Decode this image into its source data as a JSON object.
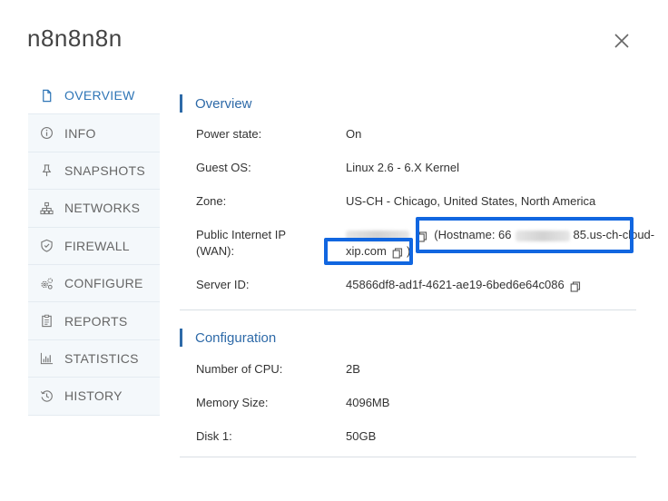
{
  "title": "n8n8n8n",
  "sidebar": {
    "items": [
      {
        "label": "OVERVIEW",
        "icon": "document-icon",
        "active": true
      },
      {
        "label": "INFO",
        "icon": "info-icon"
      },
      {
        "label": "SNAPSHOTS",
        "icon": "pin-icon"
      },
      {
        "label": "NETWORKS",
        "icon": "network-icon"
      },
      {
        "label": "FIREWALL",
        "icon": "shield-icon"
      },
      {
        "label": "CONFIGURE",
        "icon": "gears-icon"
      },
      {
        "label": "REPORTS",
        "icon": "clipboard-icon"
      },
      {
        "label": "STATISTICS",
        "icon": "bar-chart-icon"
      },
      {
        "label": "HISTORY",
        "icon": "history-icon"
      }
    ]
  },
  "overview": {
    "title": "Overview",
    "power_label": "Power state:",
    "power_value": "On",
    "os_label": "Guest OS:",
    "os_value": "Linux 2.6 - 6.X Kernel",
    "zone_label": "Zone:",
    "zone_value": "US-CH - Chicago, United States, North America",
    "ip_label_line1": "Public Internet IP",
    "ip_label_line2": "(WAN):",
    "hostname_prefix": "(Hostname: 66",
    "hostname_suffix": "85.us-ch-cloud-",
    "hostname_line2": "xip.com",
    "hostname_close": ")",
    "server_id_label": "Server ID:",
    "server_id_value": "45866df8-ad1f-4621-ae19-6bed6e64c086"
  },
  "configuration": {
    "title": "Configuration",
    "cpu_label": "Number of CPU:",
    "cpu_value": "2B",
    "memory_label": "Memory Size:",
    "memory_value": "4096MB",
    "disk_label": "Disk 1:",
    "disk_value": "50GB"
  },
  "colors": {
    "accent": "#2e6aa8",
    "highlight": "#1166e0",
    "sidebar_bg": "#f4f8fb"
  }
}
